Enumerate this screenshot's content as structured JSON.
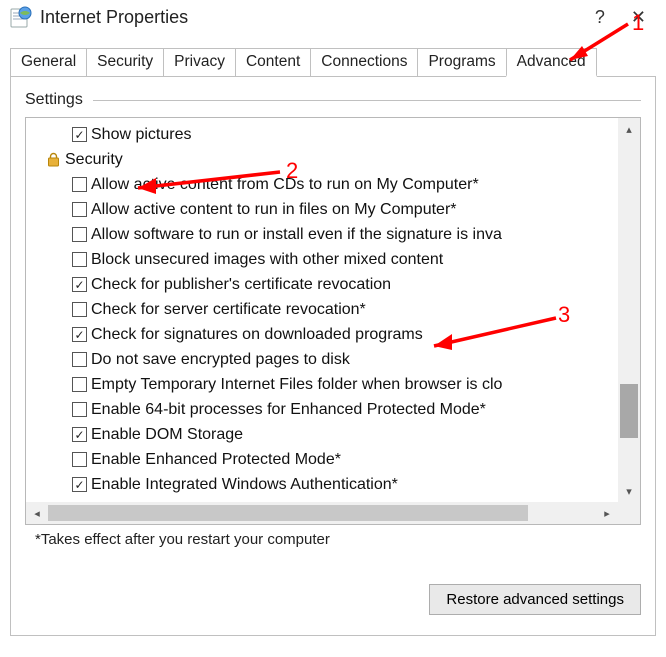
{
  "window": {
    "title": "Internet Properties",
    "help_glyph": "?",
    "close_glyph": "✕"
  },
  "tabs": {
    "items": [
      "General",
      "Security",
      "Privacy",
      "Content",
      "Connections",
      "Programs",
      "Advanced"
    ],
    "active": "Advanced"
  },
  "group": {
    "label": "Settings"
  },
  "tree": {
    "first": {
      "label": "Show pictures",
      "checked": true
    },
    "category": {
      "label": "Security"
    },
    "items": [
      {
        "label": "Allow active content from CDs to run on My Computer*",
        "checked": false
      },
      {
        "label": "Allow active content to run in files on My Computer*",
        "checked": false
      },
      {
        "label": "Allow software to run or install even if the signature is inva",
        "checked": false
      },
      {
        "label": "Block unsecured images with other mixed content",
        "checked": false
      },
      {
        "label": "Check for publisher's certificate revocation",
        "checked": true
      },
      {
        "label": "Check for server certificate revocation*",
        "checked": false
      },
      {
        "label": "Check for signatures on downloaded programs",
        "checked": true
      },
      {
        "label": "Do not save encrypted pages to disk",
        "checked": false
      },
      {
        "label": "Empty Temporary Internet Files folder when browser is clo",
        "checked": false
      },
      {
        "label": "Enable 64-bit processes for Enhanced Protected Mode*",
        "checked": false
      },
      {
        "label": "Enable DOM Storage",
        "checked": true
      },
      {
        "label": "Enable Enhanced Protected Mode*",
        "checked": false
      },
      {
        "label": "Enable Integrated Windows Authentication*",
        "checked": true
      }
    ]
  },
  "note": "*Takes effect after you restart your computer",
  "buttons": {
    "restore": "Restore advanced settings"
  },
  "annotations": {
    "one": "1",
    "two": "2",
    "three": "3"
  }
}
